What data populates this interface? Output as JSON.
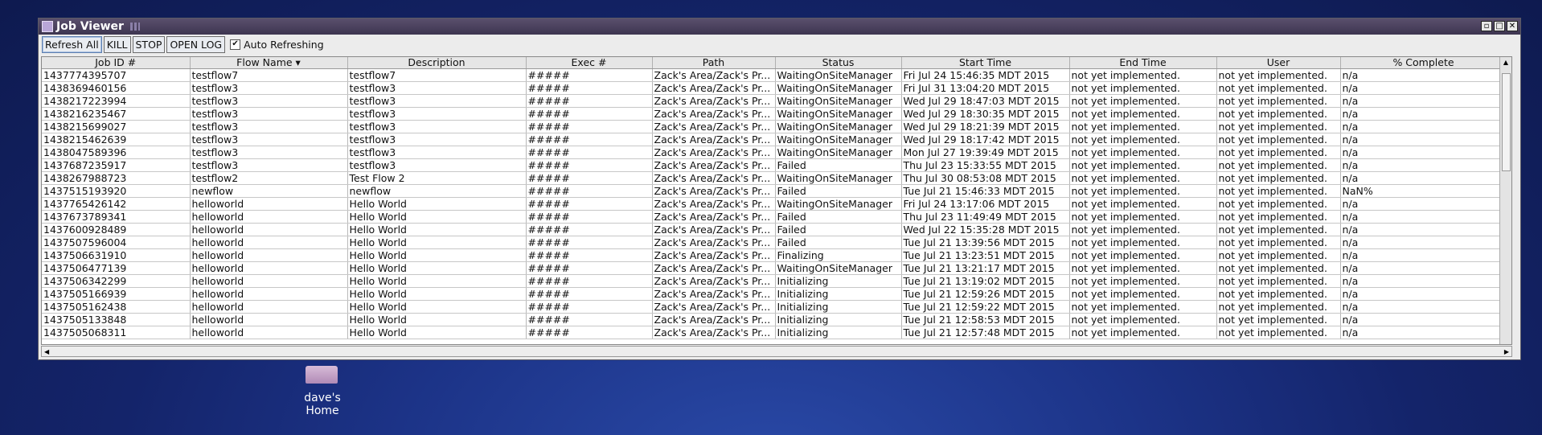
{
  "window": {
    "title": "Job Viewer",
    "buttons": {
      "minimize": "▫",
      "maximize": "□",
      "close": "✕"
    }
  },
  "toolbar": {
    "refresh_all": "Refresh All",
    "kill": "KILL",
    "stop": "STOP",
    "open_log": "OPEN LOG",
    "auto_refreshing": "Auto Refreshing",
    "auto_checked": "✔"
  },
  "table": {
    "columns": [
      "Job ID #",
      "Flow Name ▾",
      "Description",
      "Exec #",
      "Path",
      "Status",
      "Start Time",
      "End Time",
      "User",
      "% Complete"
    ],
    "rows": [
      [
        "1437774395707",
        "testflow7",
        "testflow7",
        "#####",
        "Zack's Area/Zack's Pr...",
        "WaitingOnSiteManager",
        "Fri Jul 24 15:46:35 MDT 2015",
        "not yet implemented.",
        "not yet implemented.",
        "n/a"
      ],
      [
        "1438369460156",
        "testflow3",
        "testflow3",
        "#####",
        "Zack's Area/Zack's Pr...",
        "WaitingOnSiteManager",
        "Fri Jul 31 13:04:20 MDT 2015",
        "not yet implemented.",
        "not yet implemented.",
        "n/a"
      ],
      [
        "1438217223994",
        "testflow3",
        "testflow3",
        "#####",
        "Zack's Area/Zack's Pr...",
        "WaitingOnSiteManager",
        "Wed Jul 29 18:47:03 MDT 2015",
        "not yet implemented.",
        "not yet implemented.",
        "n/a"
      ],
      [
        "1438216235467",
        "testflow3",
        "testflow3",
        "#####",
        "Zack's Area/Zack's Pr...",
        "WaitingOnSiteManager",
        "Wed Jul 29 18:30:35 MDT 2015",
        "not yet implemented.",
        "not yet implemented.",
        "n/a"
      ],
      [
        "1438215699027",
        "testflow3",
        "testflow3",
        "#####",
        "Zack's Area/Zack's Pr...",
        "WaitingOnSiteManager",
        "Wed Jul 29 18:21:39 MDT 2015",
        "not yet implemented.",
        "not yet implemented.",
        "n/a"
      ],
      [
        "1438215462639",
        "testflow3",
        "testflow3",
        "#####",
        "Zack's Area/Zack's Pr...",
        "WaitingOnSiteManager",
        "Wed Jul 29 18:17:42 MDT 2015",
        "not yet implemented.",
        "not yet implemented.",
        "n/a"
      ],
      [
        "1438047589396",
        "testflow3",
        "testflow3",
        "#####",
        "Zack's Area/Zack's Pr...",
        "WaitingOnSiteManager",
        "Mon Jul 27 19:39:49 MDT 2015",
        "not yet implemented.",
        "not yet implemented.",
        "n/a"
      ],
      [
        "1437687235917",
        "testflow3",
        "testflow3",
        "#####",
        "Zack's Area/Zack's Pr...",
        "Failed",
        "Thu Jul 23 15:33:55 MDT 2015",
        "not yet implemented.",
        "not yet implemented.",
        "n/a"
      ],
      [
        "1438267988723",
        "testflow2",
        "Test Flow 2",
        "#####",
        "Zack's Area/Zack's Pr...",
        "WaitingOnSiteManager",
        "Thu Jul 30 08:53:08 MDT 2015",
        "not yet implemented.",
        "not yet implemented.",
        "n/a"
      ],
      [
        "1437515193920",
        "newflow",
        "newflow",
        "#####",
        "Zack's Area/Zack's Pr...",
        "Failed",
        "Tue Jul 21 15:46:33 MDT 2015",
        "not yet implemented.",
        "not yet implemented.",
        "NaN%"
      ],
      [
        "1437765426142",
        "helloworld",
        "Hello World",
        "#####",
        "Zack's Area/Zack's Pr...",
        "WaitingOnSiteManager",
        "Fri Jul 24 13:17:06 MDT 2015",
        "not yet implemented.",
        "not yet implemented.",
        "n/a"
      ],
      [
        "1437673789341",
        "helloworld",
        "Hello World",
        "#####",
        "Zack's Area/Zack's Pr...",
        "Failed",
        "Thu Jul 23 11:49:49 MDT 2015",
        "not yet implemented.",
        "not yet implemented.",
        "n/a"
      ],
      [
        "1437600928489",
        "helloworld",
        "Hello World",
        "#####",
        "Zack's Area/Zack's Pr...",
        "Failed",
        "Wed Jul 22 15:35:28 MDT 2015",
        "not yet implemented.",
        "not yet implemented.",
        "n/a"
      ],
      [
        "1437507596004",
        "helloworld",
        "Hello World",
        "#####",
        "Zack's Area/Zack's Pr...",
        "Failed",
        "Tue Jul 21 13:39:56 MDT 2015",
        "not yet implemented.",
        "not yet implemented.",
        "n/a"
      ],
      [
        "1437506631910",
        "helloworld",
        "Hello World",
        "#####",
        "Zack's Area/Zack's Pr...",
        "Finalizing",
        "Tue Jul 21 13:23:51 MDT 2015",
        "not yet implemented.",
        "not yet implemented.",
        "n/a"
      ],
      [
        "1437506477139",
        "helloworld",
        "Hello World",
        "#####",
        "Zack's Area/Zack's Pr...",
        "WaitingOnSiteManager",
        "Tue Jul 21 13:21:17 MDT 2015",
        "not yet implemented.",
        "not yet implemented.",
        "n/a"
      ],
      [
        "1437506342299",
        "helloworld",
        "Hello World",
        "#####",
        "Zack's Area/Zack's Pr...",
        "Initializing",
        "Tue Jul 21 13:19:02 MDT 2015",
        "not yet implemented.",
        "not yet implemented.",
        "n/a"
      ],
      [
        "1437505166939",
        "helloworld",
        "Hello World",
        "#####",
        "Zack's Area/Zack's Pr...",
        "Initializing",
        "Tue Jul 21 12:59:26 MDT 2015",
        "not yet implemented.",
        "not yet implemented.",
        "n/a"
      ],
      [
        "1437505162438",
        "helloworld",
        "Hello World",
        "#####",
        "Zack's Area/Zack's Pr...",
        "Initializing",
        "Tue Jul 21 12:59:22 MDT 2015",
        "not yet implemented.",
        "not yet implemented.",
        "n/a"
      ],
      [
        "1437505133848",
        "helloworld",
        "Hello World",
        "#####",
        "Zack's Area/Zack's Pr...",
        "Initializing",
        "Tue Jul 21 12:58:53 MDT 2015",
        "not yet implemented.",
        "not yet implemented.",
        "n/a"
      ],
      [
        "1437505068311",
        "helloworld",
        "Hello World",
        "#####",
        "Zack's Area/Zack's Pr...",
        "Initializing",
        "Tue Jul 21 12:57:48 MDT 2015",
        "not yet implemented.",
        "not yet implemented.",
        "n/a"
      ]
    ]
  },
  "desktop": {
    "folder_label": "dave's Home"
  },
  "colors": {
    "titlebar": "#4a405f",
    "desktop": "#1c3387"
  }
}
